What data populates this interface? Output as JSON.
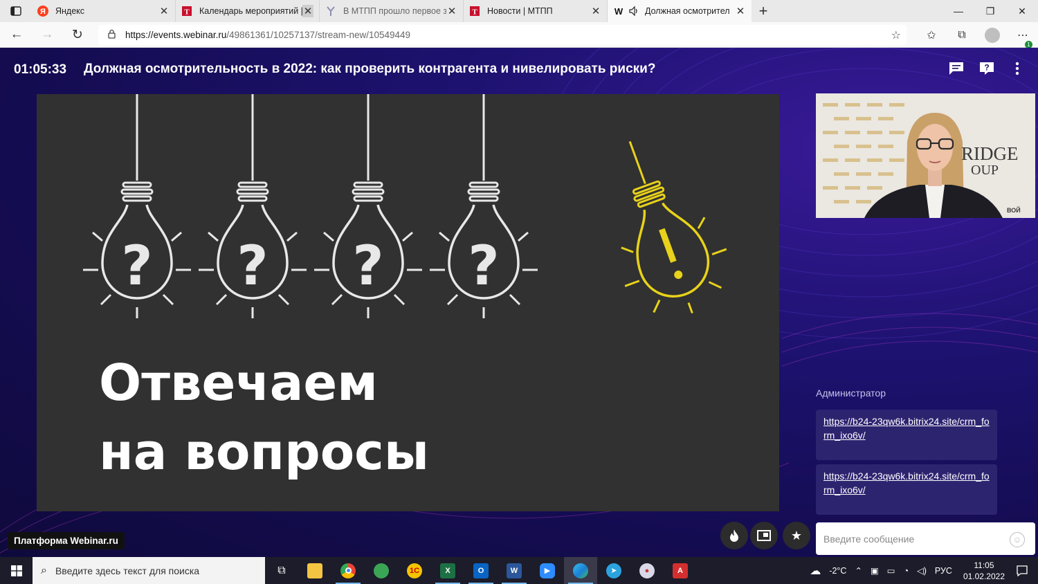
{
  "browser": {
    "tabs": [
      {
        "title": "Яндекс",
        "icon": "yandex-icon",
        "active": false
      },
      {
        "title": "Календарь мероприятий |",
        "icon": "mtpp-icon",
        "active": false
      },
      {
        "title": "В МТПП прошло первое з",
        "icon": "mtpp-emblem-icon",
        "active": false
      },
      {
        "title": "Новости | МТПП",
        "icon": "mtpp-icon",
        "active": false
      },
      {
        "title": "Должная осмотрител",
        "icon": "webinar-w-icon",
        "active": true
      }
    ],
    "url_host": "https://events.webinar.ru",
    "url_path": "/49861361/10257137/stream-new/10549449",
    "extension_badge": "1"
  },
  "webinar": {
    "timer": "01:05:33",
    "title": "Должная осмотрительность в 2022: как проверить контрагента и нивелировать риски?",
    "slide": {
      "line1": "Отвечаем",
      "line2": "на вопросы"
    },
    "webcam": {
      "backdrop_text_1": "RIDGE",
      "backdrop_text_2": "OUP",
      "backdrop_text_3": "ВОЙ"
    },
    "chat": {
      "author": "Администратор",
      "messages": [
        "https://b24-23qw6k.bitrix24.site/crm_form_ixo6v/",
        "https://b24-23qw6k.bitrix24.site/crm_form_ixo6v/"
      ],
      "input_placeholder": "Введите сообщение"
    },
    "platform_badge": "Платформа Webinar.ru"
  },
  "taskbar": {
    "search_placeholder": "Введите здесь текст для поиска",
    "temperature": "-2°C",
    "language": "РУС",
    "time": "11:05",
    "date": "01.02.2022"
  },
  "colors": {
    "page_bg": "#1a0f5c",
    "chat_bubble": "#2d2470",
    "slide_bg": "#313131",
    "accent_yellow": "#e8d21a"
  }
}
